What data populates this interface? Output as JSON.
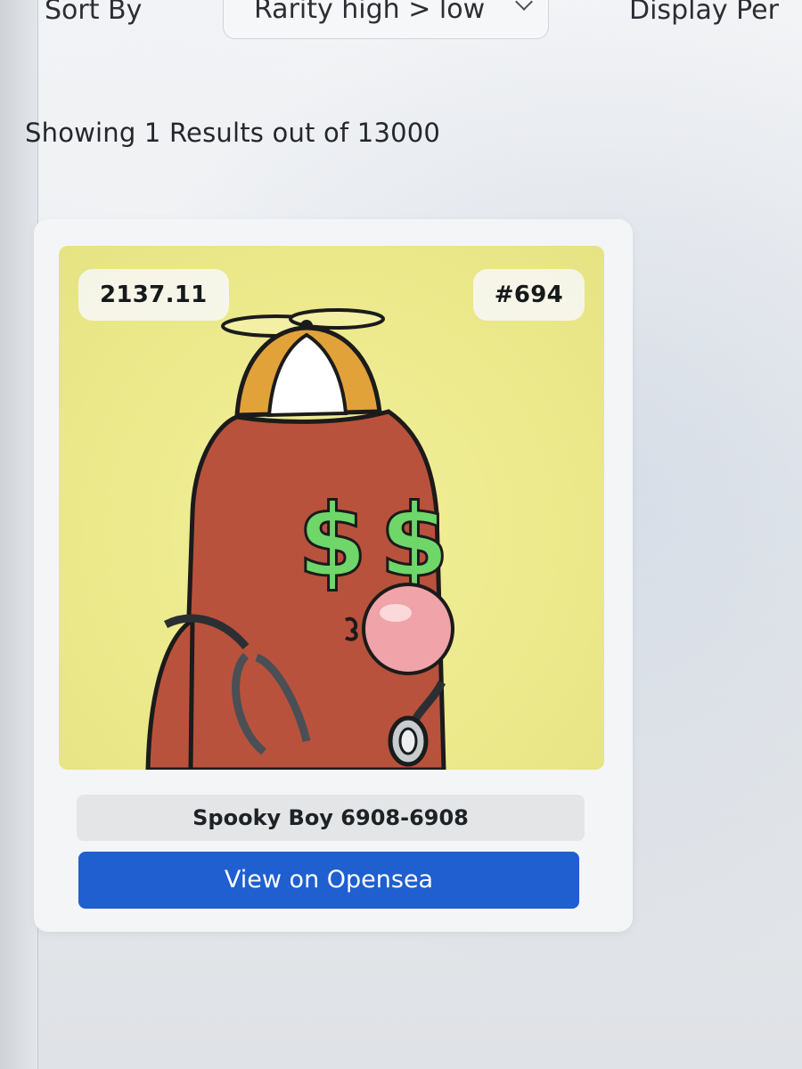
{
  "controls": {
    "sort_label": "Sort By",
    "sort_value": "Rarity high > low",
    "display_label": "Display Per"
  },
  "results": {
    "text": "Showing 1 Results out of 13000"
  },
  "card": {
    "score": "2137.11",
    "rank": "#694",
    "name": "Spooky Boy 6908-6908",
    "button_label": "View on Opensea",
    "image": {
      "description_icons": [
        "propeller-hat",
        "dollar-sign-eyes",
        "bubblegum",
        "stethoscope"
      ]
    }
  },
  "colors": {
    "accent": "#1f5fcf",
    "art_background": "#ecea8c",
    "character_body": "#b9523c",
    "dollar_eyes": "#6fd66a",
    "bubblegum": "#f0a3a8",
    "hat": "#e2a23a"
  }
}
